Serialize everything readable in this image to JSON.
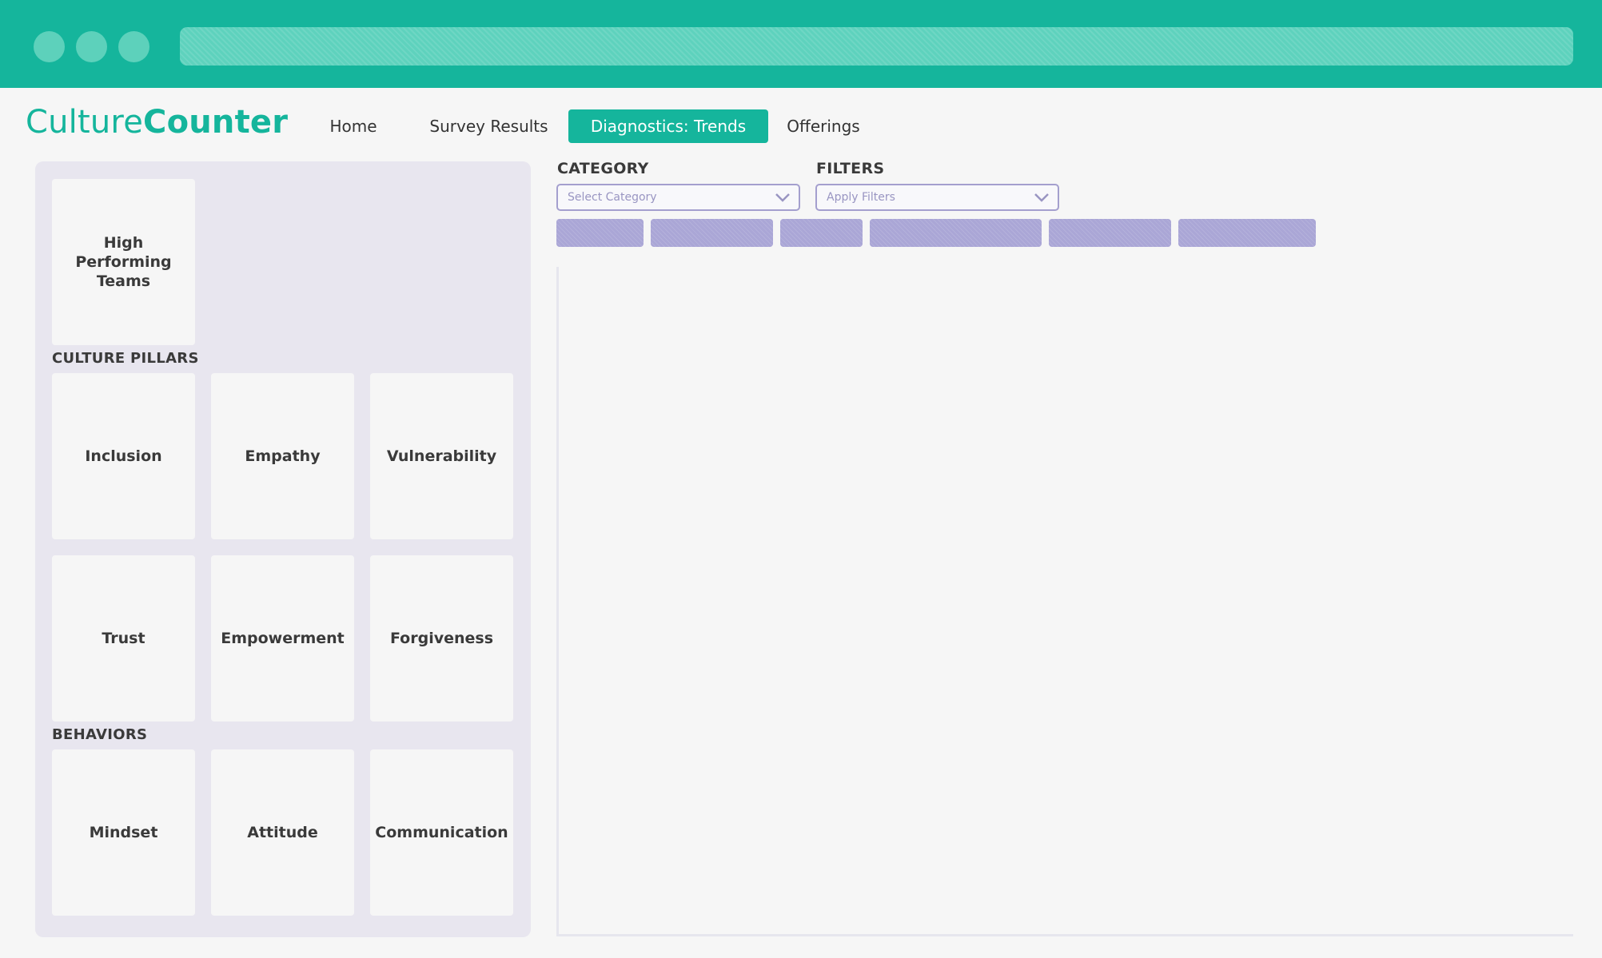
{
  "app": {
    "logo_light": "Culture",
    "logo_bold": "Counter"
  },
  "nav": {
    "home": "Home",
    "survey_results": "Survey Results",
    "diagnostics_trends": "Diagnostics: Trends",
    "offerings": "Offerings"
  },
  "sidebar": {
    "featured": "High Performing Teams",
    "culture_pillars_heading": "CULTURE PILLARS",
    "culture_pillars": [
      "Inclusion",
      "Empathy",
      "Vulnerability",
      "Trust",
      "Empowerment",
      "Forgiveness"
    ],
    "behaviors_heading": "BEHAVIORS",
    "behaviors": [
      "Mindset",
      "Attitude",
      "Communication"
    ]
  },
  "filters": {
    "category_label": "CATEGORY",
    "category_placeholder": "Select Category",
    "filters_label": "FILTERS",
    "filters_placeholder": "Apply Filters"
  },
  "colors": {
    "brand": "#15b59c",
    "chip": "#aaa6d6",
    "panel": "#e8e6ef"
  },
  "icons": {
    "dropdown": "chevron-down-icon"
  }
}
